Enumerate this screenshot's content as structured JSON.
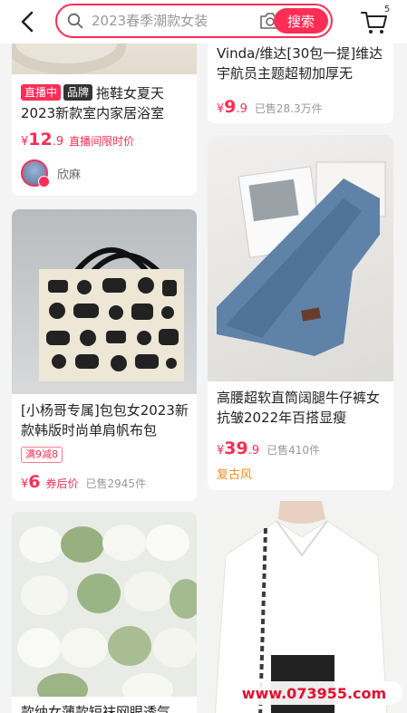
{
  "header": {
    "search_placeholder": "2023春季潮款女装",
    "search_button": "搜索",
    "cart_count": "5"
  },
  "products": [
    {
      "tags": [
        "直播中",
        "品牌"
      ],
      "title": "拖鞋女夏天2023新款室内家居浴室",
      "price_int": "12",
      "price_dec": ".9",
      "price_label": "直播间限时价",
      "shop_name": "欣麻"
    },
    {
      "title": "Vinda/维达[30包一提]维达宇航员主题超韧加厚无",
      "price_int": "9",
      "price_dec": ".9",
      "sold": "已售28.3万件"
    },
    {
      "title": "[小杨哥专属]包包女2023新款韩版时尚单肩帆布包",
      "coupon": "满9减8",
      "price_int": "6",
      "price_label": "券后价",
      "sold": "已售2945件"
    },
    {
      "title": "高腰超软直筒阔腿牛仔裤女抗皱2022年百搭显瘦",
      "price_int": "39",
      "price_dec": ".9",
      "sold": "已售410件",
      "style_tag": "复古风"
    },
    {
      "title": "款纳女薄款短袜网眼透气"
    }
  ],
  "currency": "¥",
  "watermark": "www.073955.com",
  "colors": {
    "accent": "#ff2d55",
    "style_tag": "#f08c2a"
  }
}
